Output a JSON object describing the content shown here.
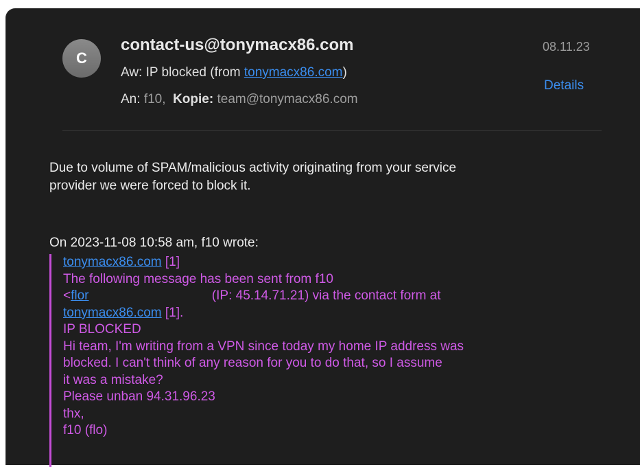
{
  "message": {
    "avatar_initial": "C",
    "sender": "contact-us@tonymacx86.com",
    "date": "08.11.23",
    "subject_prefix": "Aw: IP blocked (from ",
    "subject_link": "tonymacx86.com",
    "subject_suffix": ")",
    "details_label": "Details",
    "to_label": "An:",
    "to_value": "f10,",
    "cc_label": "Kopie:",
    "cc_value": "team@tonymacx86.com"
  },
  "body": {
    "line1": "Due to volume of SPAM/malicious activity originating from your service",
    "line2": "provider we were forced to block it."
  },
  "quote": {
    "intro": "On 2023-11-08 10:58 am, f10 wrote:",
    "l1_link": "tonymacx86.com",
    "l1_ref": " [1]",
    "l2": "The following message has been sent from f10",
    "l3_prefix": "<",
    "l3_link": "flor",
    "l3_suffix": "(IP: 45.14.71.21) via the contact form at",
    "l4_link": "tonymacx86.com",
    "l4_ref": " [1].",
    "l5": "IP BLOCKED",
    "l6": "Hi team, I'm writing from a VPN since today my home IP address was",
    "l7": "blocked. I can't think of any reason for you to do that, so I assume",
    "l8": "it was a mistake?",
    "l9": "Please unban 94.31.96.23",
    "l10": "thx,",
    "l11": "f10 (flo)"
  }
}
